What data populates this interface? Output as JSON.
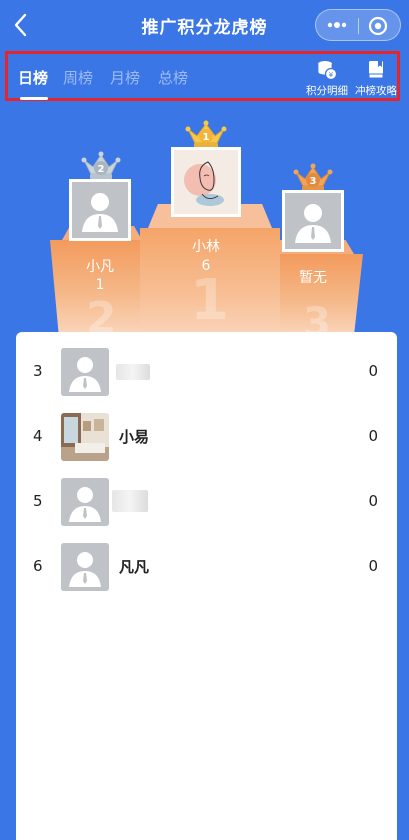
{
  "nav": {
    "title": "推广积分龙虎榜"
  },
  "tabs": [
    {
      "label": "日榜",
      "active": true
    },
    {
      "label": "周榜",
      "active": false
    },
    {
      "label": "月榜",
      "active": false
    },
    {
      "label": "总榜",
      "active": false
    }
  ],
  "tools": [
    {
      "label": "积分明细",
      "icon": "coins-icon"
    },
    {
      "label": "冲榜攻略",
      "icon": "book-icon"
    }
  ],
  "podium": {
    "first": {
      "rank": "1",
      "name": "小林",
      "score": "6"
    },
    "second": {
      "rank": "2",
      "name": "小凡",
      "score": "1"
    },
    "third": {
      "rank": "3",
      "name": "暂无"
    }
  },
  "list": [
    {
      "rank": "3",
      "name": "",
      "score": "0"
    },
    {
      "rank": "4",
      "name": "小易",
      "score": "0"
    },
    {
      "rank": "5",
      "name": "",
      "score": "0"
    },
    {
      "rank": "6",
      "name": "凡凡",
      "score": "0"
    }
  ],
  "colors": {
    "background": "#3b76e6",
    "highlight_border": "#e5252c",
    "podium": "#f39a5c"
  }
}
